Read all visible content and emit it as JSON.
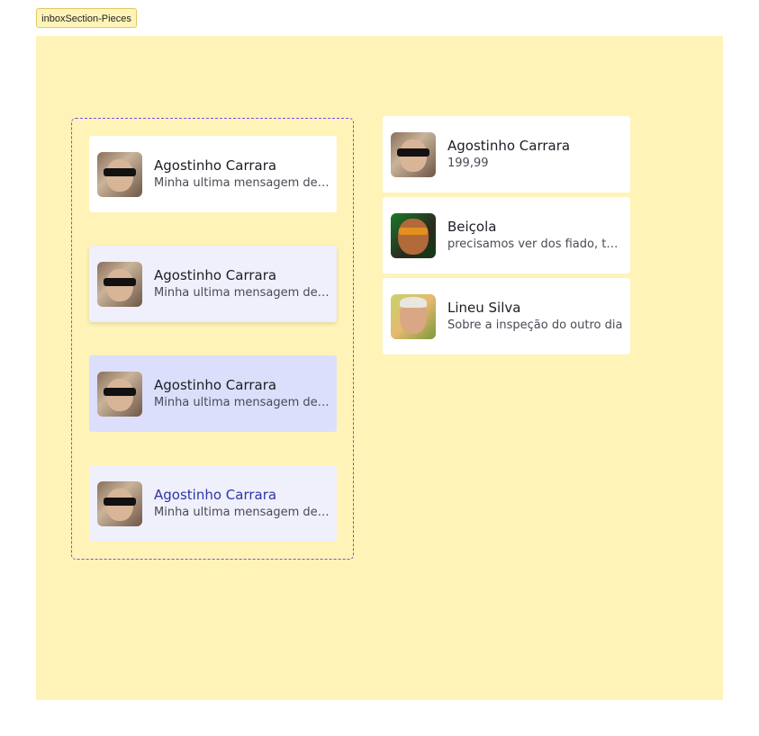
{
  "frame_label": "inboxSection-Pieces",
  "variants": [
    {
      "name": "Agostinho Carrara",
      "message": "Minha ultima mensagem des...",
      "avatar": "agostinho-avatar",
      "state": "default"
    },
    {
      "name": "Agostinho Carrara",
      "message": "Minha ultima mensagem des...",
      "avatar": "agostinho-avatar",
      "state": "hover"
    },
    {
      "name": "Agostinho Carrara",
      "message": "Minha ultima mensagem des...",
      "avatar": "agostinho-avatar",
      "state": "active"
    },
    {
      "name": "Agostinho Carrara",
      "message": "Minha ultima mensagem des...",
      "avatar": "agostinho-avatar",
      "state": "selected"
    }
  ],
  "list": [
    {
      "name": "Agostinho Carrara",
      "message": "199,99",
      "avatar": "agostinho-avatar"
    },
    {
      "name": "Beiçola",
      "message": "precisamos ver dos fiado, te...",
      "avatar": "beicola-avatar"
    },
    {
      "name": "Lineu Silva",
      "message": "Sobre a inspeção do outro dia",
      "avatar": "lineu-avatar"
    }
  ],
  "colors": {
    "canvas": "#fff3b8",
    "hover": "#eff0fb",
    "active": "#dcdffb",
    "selected_name": "#2d34a8",
    "dashed_border": "#7b52e8"
  }
}
